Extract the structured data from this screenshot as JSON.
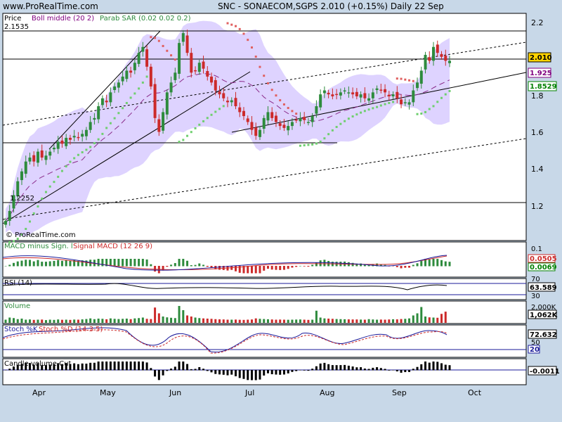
{
  "header": {
    "site": "www.ProRealTime.com",
    "title": "SNC - SONAECOM,SGPS    2.010 (+0.15%)    Daily  22 Sep"
  },
  "watermark": "© ProRealTime.com",
  "price_panel": {
    "legend": {
      "price": "Price",
      "boll": "Boll middle (20 2)",
      "sar": "Parab SAR (0.02 0.02 0.2)"
    },
    "hi_label": "2.1535",
    "lo_label": "1.2252",
    "y_ticks": [
      "2.2",
      "2",
      "1.8",
      "1.6",
      "1.4",
      "1.2"
    ],
    "badges": [
      {
        "text": "2.010",
        "bg": "#ffd400",
        "fg": "#000000"
      },
      {
        "text": "1.925",
        "bg": "#ffffff",
        "fg": "#800080"
      },
      {
        "text": "1.8529",
        "bg": "#ffffff",
        "fg": "#008000"
      }
    ]
  },
  "macd_panel": {
    "legend_a": "MACD minus Sign. l",
    "legend_b": "Signal MACD (12 26 9)",
    "top_tick": "0.1",
    "badges": [
      {
        "text": "0.0505",
        "fg": "#cc0000"
      },
      {
        "text": "0.0069",
        "fg": "#008000"
      }
    ]
  },
  "rsi_panel": {
    "legend": "RSI (14)",
    "badge": "63.589",
    "t1": "70",
    "t2": "30"
  },
  "volume_panel": {
    "legend": "Volume",
    "top_tick": "2,000K",
    "badge": "1,062K"
  },
  "stoch_panel": {
    "legend_a": "Stoch %K",
    "legend_b": "Stoch %D (14 3 5)",
    "badge": "72.632",
    "t1": "50",
    "t2": "20"
  },
  "bottom_panel": {
    "legend": "Candle volume Cut",
    "badge": "-0.0011"
  },
  "x_axis": {
    "labels": [
      "Apr",
      "May",
      "Jun",
      "Jul",
      "Aug",
      "Sep",
      "Oct"
    ]
  },
  "colors": {
    "up": "#2e8b3d",
    "down": "#cc2a2a",
    "band": "#d6c8ff",
    "sar_up": "#6fcf6f",
    "sar_down": "#e06060",
    "boll": "#8a2b8a"
  },
  "chart_data": {
    "type": "candlestick",
    "title": "SNC - SONAECOM,SGPS",
    "ylim": [
      1.1,
      2.25
    ],
    "last_close": 2.01,
    "closes": [
      1.2,
      1.25,
      1.33,
      1.4,
      1.45,
      1.5,
      1.52,
      1.5,
      1.55,
      1.52,
      1.53,
      1.55,
      1.57,
      1.6,
      1.59,
      1.62,
      1.61,
      1.63,
      1.62,
      1.64,
      1.66,
      1.7,
      1.72,
      1.78,
      1.82,
      1.8,
      1.85,
      1.88,
      1.9,
      1.93,
      1.96,
      1.95,
      2.0,
      2.05,
      2.08,
      1.98,
      1.88,
      1.72,
      1.65,
      1.75,
      1.85,
      1.9,
      1.95,
      2.1,
      2.15,
      2.05,
      1.95,
      1.96,
      2.0,
      1.97,
      1.93,
      1.9,
      1.86,
      1.84,
      1.82,
      1.8,
      1.81,
      1.78,
      1.75,
      1.73,
      1.7,
      1.66,
      1.63,
      1.66,
      1.72,
      1.75,
      1.72,
      1.7,
      1.68,
      1.67,
      1.68,
      1.7,
      1.71,
      1.72,
      1.71,
      1.7,
      1.73,
      1.78,
      1.84,
      1.86,
      1.84,
      1.83,
      1.84,
      1.85,
      1.86,
      1.85,
      1.84,
      1.83,
      1.84,
      1.82,
      1.82,
      1.85,
      1.87,
      1.86,
      1.85,
      1.83,
      1.84,
      1.82,
      1.79,
      1.8,
      1.8,
      1.86,
      1.9,
      1.96,
      2.04,
      2.01,
      2.08,
      2.05,
      2.03,
      2.01,
      2.01
    ],
    "volume": [
      300,
      500,
      450,
      350,
      400,
      300,
      320,
      280,
      300,
      310,
      260,
      300,
      280,
      320,
      290,
      300,
      280,
      310,
      300,
      330,
      360,
      420,
      350,
      400,
      380,
      340,
      420,
      380,
      360,
      380,
      400,
      350,
      420,
      450,
      500,
      380,
      360,
      1450,
      900,
      600,
      520,
      480,
      450,
      1600,
      1200,
      700,
      600,
      500,
      450,
      420,
      400,
      380,
      350,
      330,
      320,
      300,
      300,
      310,
      290,
      280,
      300,
      320,
      420,
      380,
      360,
      340,
      320,
      300,
      310,
      300,
      290,
      300,
      310,
      320,
      300,
      280,
      300,
      1150,
      500,
      420,
      400,
      380,
      360,
      350,
      340,
      330,
      320,
      320,
      310,
      300,
      350,
      320,
      300,
      310,
      300,
      320,
      340,
      330,
      360,
      380,
      420,
      700,
      900,
      1500,
      600,
      520,
      500,
      480,
      850,
      1060
    ]
  }
}
